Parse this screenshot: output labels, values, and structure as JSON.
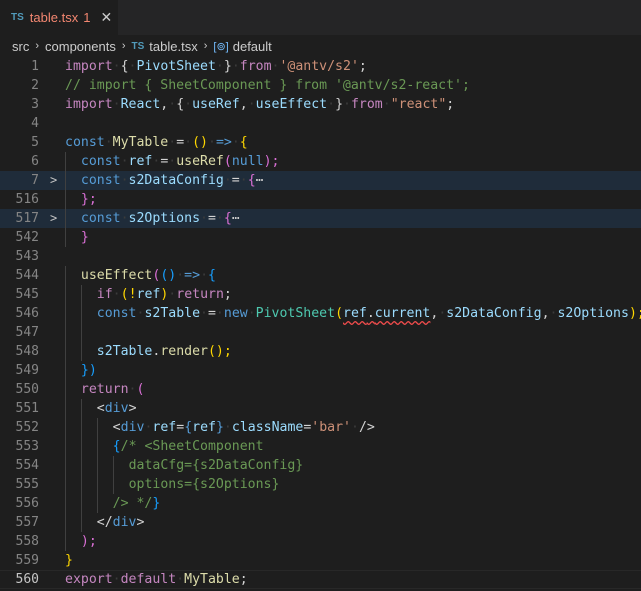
{
  "tab": {
    "lang_badge": "TS",
    "filename": "table.tsx",
    "problem_count": "1",
    "close_glyph": "✕"
  },
  "breadcrumb": {
    "parts": [
      "src",
      "components",
      "table.tsx",
      "default"
    ],
    "ts_badge": "TS",
    "symbol_glyph": "[⊚]",
    "chevron": "›"
  },
  "colors": {
    "keyword": "#569cd6",
    "control": "#c586c0",
    "function": "#dcdcaa",
    "variable": "#9cdcfe",
    "string": "#ce9178",
    "comment": "#6a9955",
    "class": "#4ec9b0",
    "tab_error": "#f48771"
  },
  "lines": [
    {
      "num": "1"
    },
    {
      "num": "2"
    },
    {
      "num": "3"
    },
    {
      "num": "4"
    },
    {
      "num": "5"
    },
    {
      "num": "6"
    },
    {
      "num": "7",
      "folded": true
    },
    {
      "num": "516"
    },
    {
      "num": "517",
      "folded": true
    },
    {
      "num": "542"
    },
    {
      "num": "543"
    },
    {
      "num": "544"
    },
    {
      "num": "545"
    },
    {
      "num": "546"
    },
    {
      "num": "547"
    },
    {
      "num": "548"
    },
    {
      "num": "549"
    },
    {
      "num": "550"
    },
    {
      "num": "551"
    },
    {
      "num": "552"
    },
    {
      "num": "553"
    },
    {
      "num": "554"
    },
    {
      "num": "555"
    },
    {
      "num": "556"
    },
    {
      "num": "557"
    },
    {
      "num": "558"
    },
    {
      "num": "559"
    },
    {
      "num": "560"
    }
  ],
  "code": {
    "l1": [
      "import",
      "{",
      "PivotSheet",
      "}",
      "from",
      "'@antv/s2'",
      ";"
    ],
    "l2": "// import { SheetComponent } from '@antv/s2-react';",
    "l3": [
      "import",
      "React",
      ",",
      "{",
      "useRef",
      ",",
      "useEffect",
      "}",
      "from",
      "\"react\"",
      ";"
    ],
    "l5": [
      "const",
      "MyTable",
      "=",
      "()",
      "=>",
      "{"
    ],
    "l6": [
      "const",
      "ref",
      "=",
      "useRef",
      "(",
      "null",
      ");"
    ],
    "l7": [
      "const",
      "s2DataConfig",
      "=",
      "{",
      "⋯"
    ],
    "l516": "};",
    "l517": [
      "const",
      "s2Options",
      "=",
      "{",
      "⋯"
    ],
    "l542": "}",
    "l544": [
      "useEffect",
      "(",
      "(",
      ")",
      "=>",
      "{"
    ],
    "l545": [
      "if",
      "(!",
      "ref",
      ")",
      "return",
      ";"
    ],
    "l546": [
      "const",
      "s2Table",
      "=",
      "new",
      "PivotSheet",
      "(",
      "ref",
      ".",
      "current",
      ",",
      "s2DataConfig",
      ",",
      "s2Options",
      ");"
    ],
    "l548": [
      "s2Table",
      ".",
      "render",
      "();"
    ],
    "l549": "})",
    "l550": [
      "return",
      "("
    ],
    "l551": [
      "<",
      "div",
      ">"
    ],
    "l552": [
      "<",
      "div",
      "ref",
      "=",
      "{",
      "ref",
      "}",
      "className",
      "=",
      "'bar'",
      "/>"
    ],
    "l553": [
      "{",
      "/* <SheetComponent"
    ],
    "l554": "dataCfg={s2DataConfig}",
    "l555": "options={s2Options}",
    "l556": [
      "/> */",
      "}"
    ],
    "l557": [
      "</",
      "div",
      ">"
    ],
    "l558": ");",
    "l559": "}",
    "l560": [
      "export",
      "default",
      "MyTable",
      ";"
    ]
  }
}
